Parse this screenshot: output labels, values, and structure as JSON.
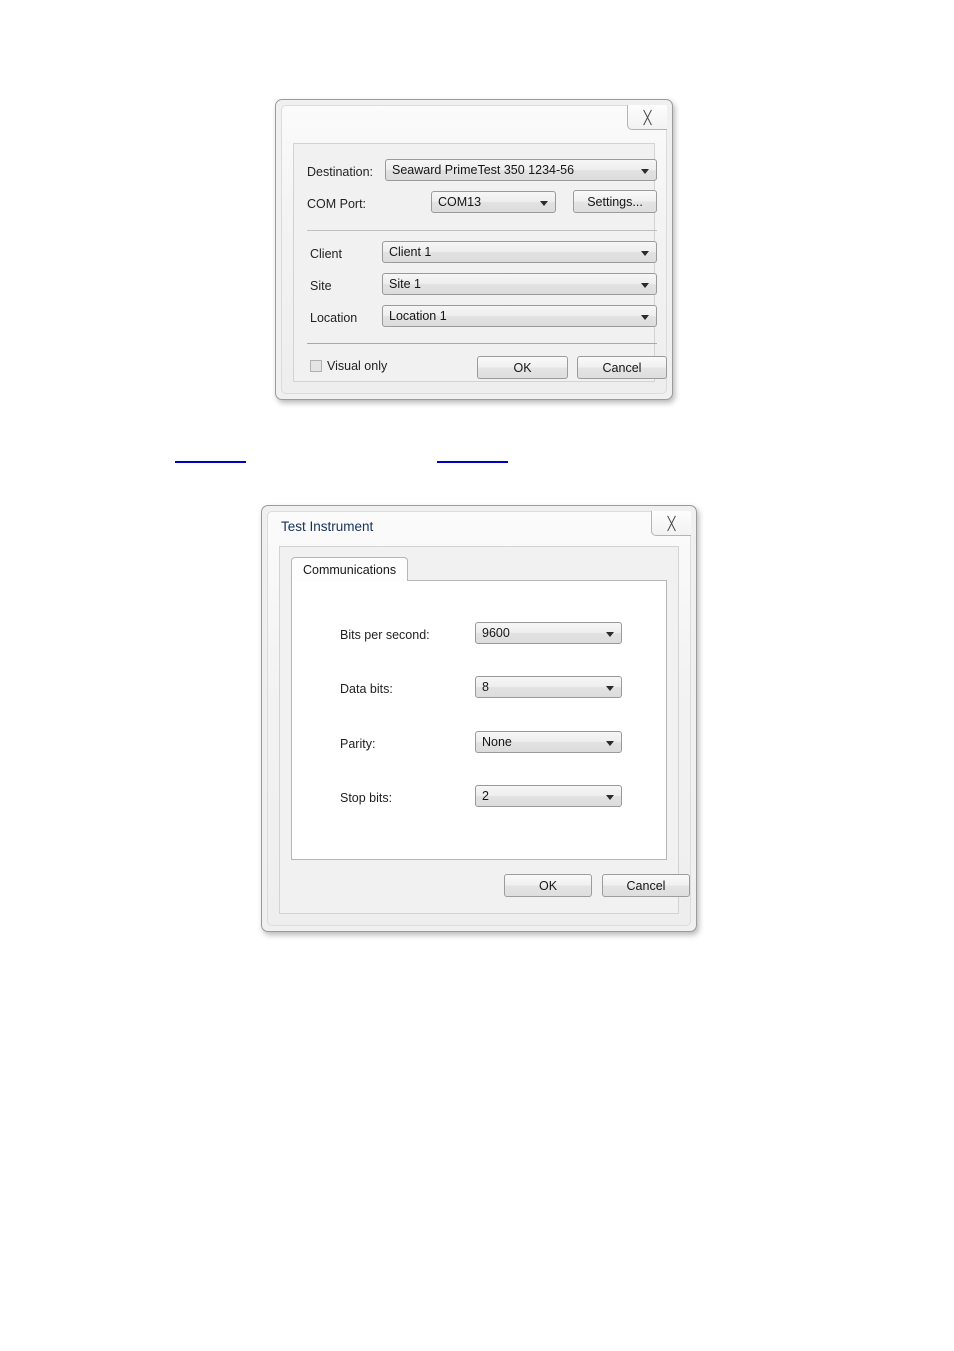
{
  "page": {
    "background": "#ffffff",
    "link_color": "#0000c8"
  },
  "dialog_destination": {
    "title": "",
    "close_glyph": "╳",
    "close_icon_name": "close-icon",
    "fields": {
      "destination": {
        "label": "Destination:",
        "value": "Seaward PrimeTest 350 1234-56"
      },
      "com_port": {
        "label": "COM Port:",
        "value": "COM13"
      },
      "client": {
        "label": "Client",
        "value": "Client 1"
      },
      "site": {
        "label": "Site",
        "value": "Site 1"
      },
      "location": {
        "label": "Location",
        "value": "Location 1"
      }
    },
    "settings_button": "Settings...",
    "visual_only_label": "Visual only",
    "visual_only_checked": false,
    "ok_button": "OK",
    "cancel_button": "Cancel"
  },
  "dialog_test_instrument": {
    "title": "Test Instrument",
    "close_glyph": "╳",
    "close_icon_name": "close-icon",
    "tabs": [
      {
        "label": "Communications",
        "selected": true
      }
    ],
    "fields": {
      "bits_per_second": {
        "label": "Bits per second:",
        "value": "9600"
      },
      "data_bits": {
        "label": "Data bits:",
        "value": "8"
      },
      "parity": {
        "label": "Parity:",
        "value": "None"
      },
      "stop_bits": {
        "label": "Stop bits:",
        "value": "2"
      }
    },
    "ok_button": "OK",
    "cancel_button": "Cancel"
  },
  "links": [
    {
      "name": "link-rule-left"
    },
    {
      "name": "link-rule-right"
    }
  ]
}
